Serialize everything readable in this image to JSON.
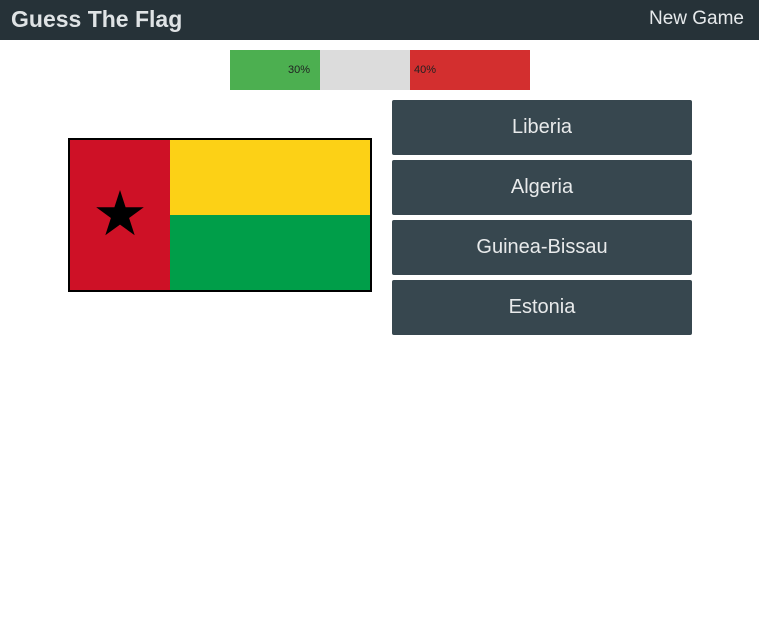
{
  "header": {
    "title": "Guess The Flag",
    "new_game_label": "New Game"
  },
  "progress": {
    "correct_label": "30%",
    "wrong_label": "40%",
    "correct_fraction": 0.3,
    "remaining_fraction": 0.3,
    "wrong_fraction": 0.4,
    "colors": {
      "correct": "#4caf50",
      "remaining": "#dcdcdc",
      "wrong": "#d32f2f"
    }
  },
  "flag": {
    "icon": "guinea-bissau-flag",
    "colors": {
      "red": "#ce1126",
      "yellow": "#fcd116",
      "green": "#009e49",
      "star": "#000000"
    }
  },
  "answers": [
    {
      "label": "Liberia"
    },
    {
      "label": "Algeria"
    },
    {
      "label": "Guinea-Bissau"
    },
    {
      "label": "Estonia"
    }
  ]
}
